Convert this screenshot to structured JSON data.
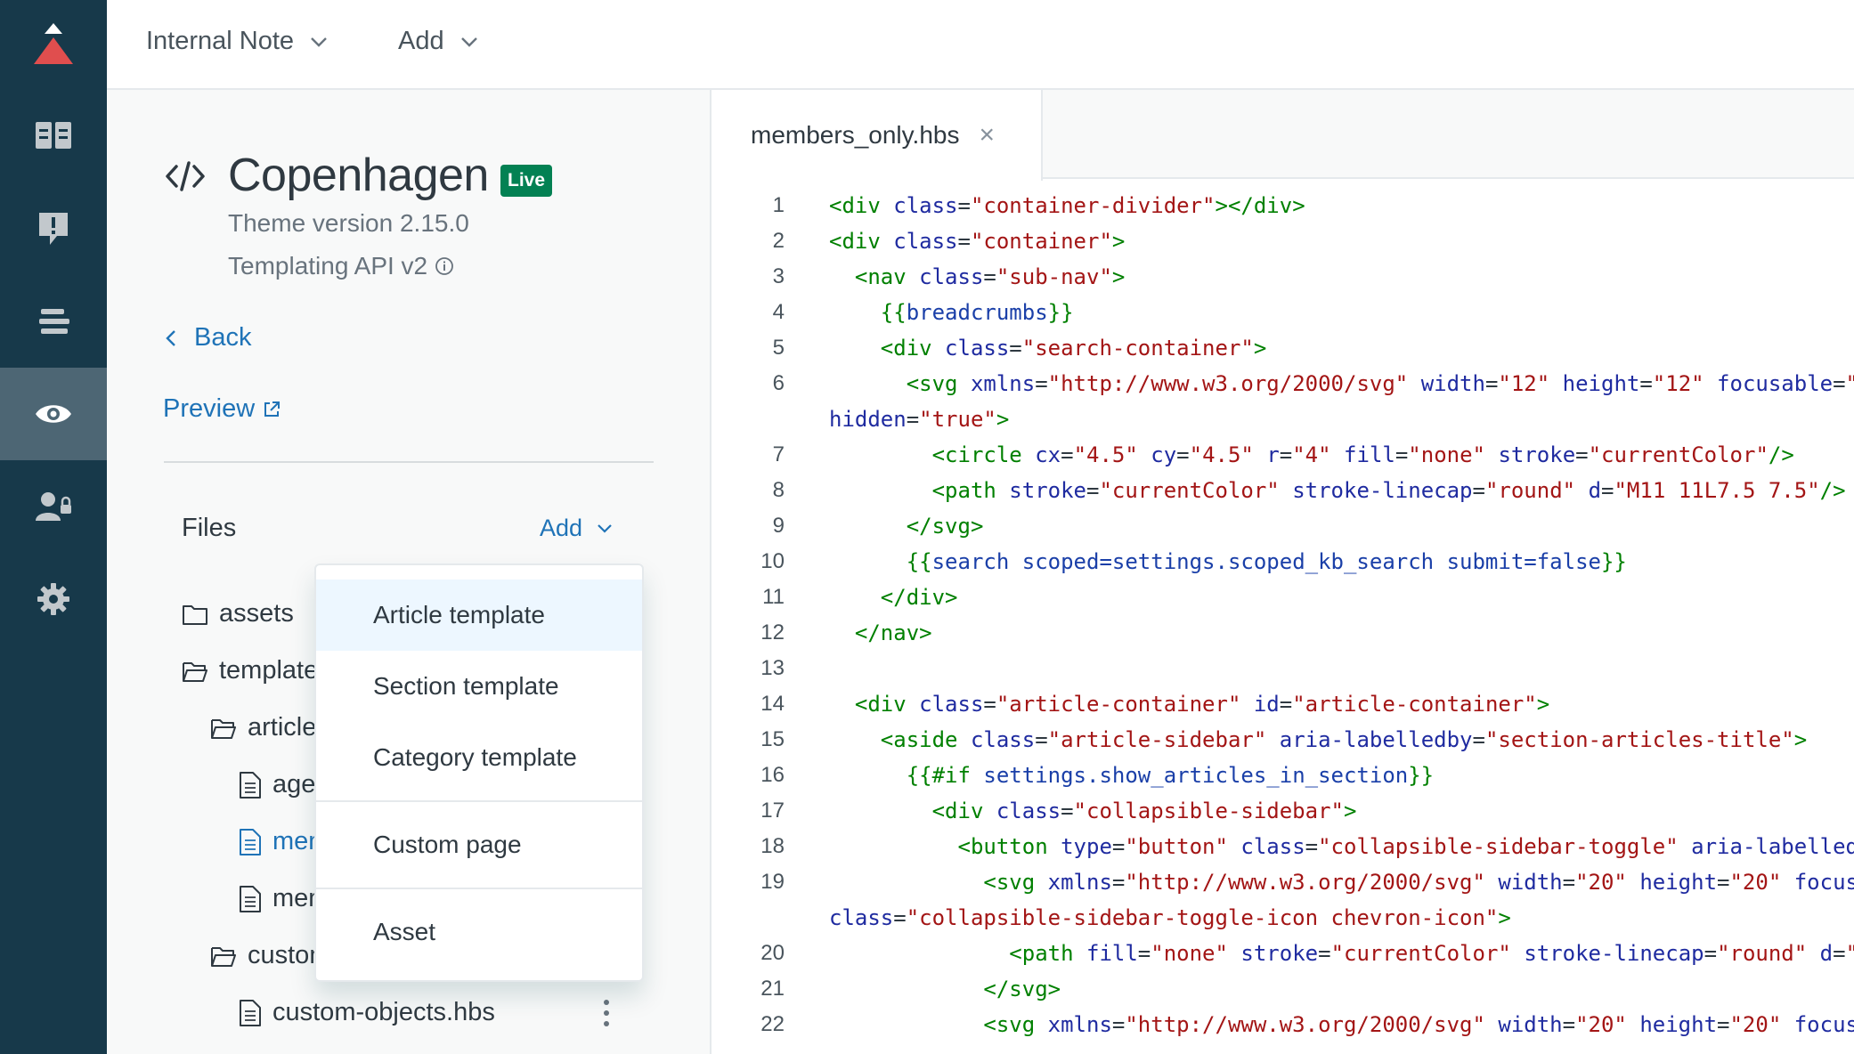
{
  "topbar": {
    "internal_note": "Internal Note",
    "add": "Add"
  },
  "theme": {
    "name": "Copenhagen",
    "badge": "Live",
    "version": "Theme version 2.15.0",
    "api": "Templating API v2"
  },
  "nav": {
    "back": "Back",
    "preview": "Preview"
  },
  "files": {
    "heading": "Files",
    "add": "Add",
    "tree": [
      {
        "label": "assets"
      },
      {
        "label": "templates"
      },
      {
        "label": "article_pages"
      },
      {
        "label": "agent.hbs"
      },
      {
        "label": "members_only.hbs"
      },
      {
        "label": "members_hidden.hbs"
      },
      {
        "label": "custom_pages"
      },
      {
        "label": "custom-objects.hbs"
      }
    ]
  },
  "dropdown": {
    "items": [
      "Article template",
      "Section template",
      "Category template",
      "Custom page",
      "Asset"
    ]
  },
  "editor": {
    "tab_label": "members_only.hbs",
    "tab_close": "×"
  },
  "colors": {
    "rail": "#17394a",
    "rail_active": "#4d6674",
    "logo": "#e04e4e",
    "link": "#1f73b7",
    "live_badge": "#038153"
  }
}
